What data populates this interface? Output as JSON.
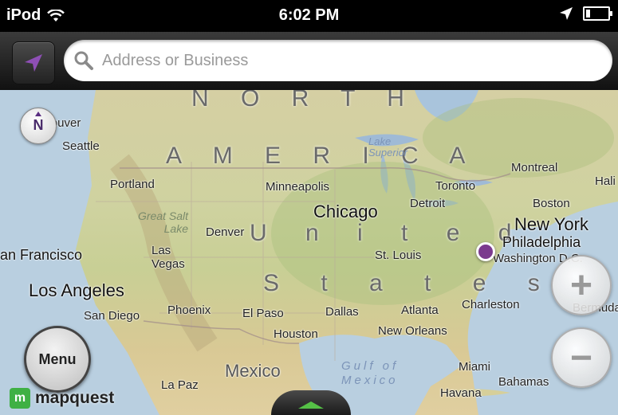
{
  "status_bar": {
    "carrier": "iPod",
    "time": "6:02 PM"
  },
  "search": {
    "placeholder": "Address or Business"
  },
  "map": {
    "north_label": "N",
    "labels": {
      "north": "N O R T H",
      "america": "A M E R I C A",
      "united": "U n i t e d",
      "states": "S t a t e s",
      "mexico": "Mexico",
      "lake_superior": "Lake Superior",
      "great_salt_lake": "Great Salt Lake",
      "gulf": "Gulf of Mexico",
      "vancouver": "ncouver",
      "seattle": "Seattle",
      "portland": "Portland",
      "san_francisco": "an Francisco",
      "los_angeles": "Los Angeles",
      "san_diego": "San Diego",
      "las_vegas": "Las Vegas",
      "phoenix": "Phoenix",
      "denver": "Denver",
      "el_paso": "El Paso",
      "la_paz": "La Paz",
      "minneapolis": "Minneapolis",
      "chicago": "Chicago",
      "st_louis": "St. Louis",
      "dallas": "Dallas",
      "houston": "Houston",
      "atlanta": "Atlanta",
      "new_orleans": "New Orleans",
      "miami": "Miami",
      "havana": "Havana",
      "bahamas": "Bahamas",
      "bermuda": "Bermuda",
      "charleston": "Charleston",
      "washington": "Washington D.C.",
      "philadelphia": "Philadelphia",
      "new_york": "New York",
      "boston": "Boston",
      "montreal": "Montreal",
      "toronto": "Toronto",
      "detroit": "Detroit",
      "halifax": "Hali"
    }
  },
  "controls": {
    "zoom_in": "+",
    "zoom_out": "−",
    "menu": "Menu"
  },
  "brand": {
    "logo_mark": "m",
    "logo_text": "mapquest",
    "accent_color": "#3fb044"
  }
}
